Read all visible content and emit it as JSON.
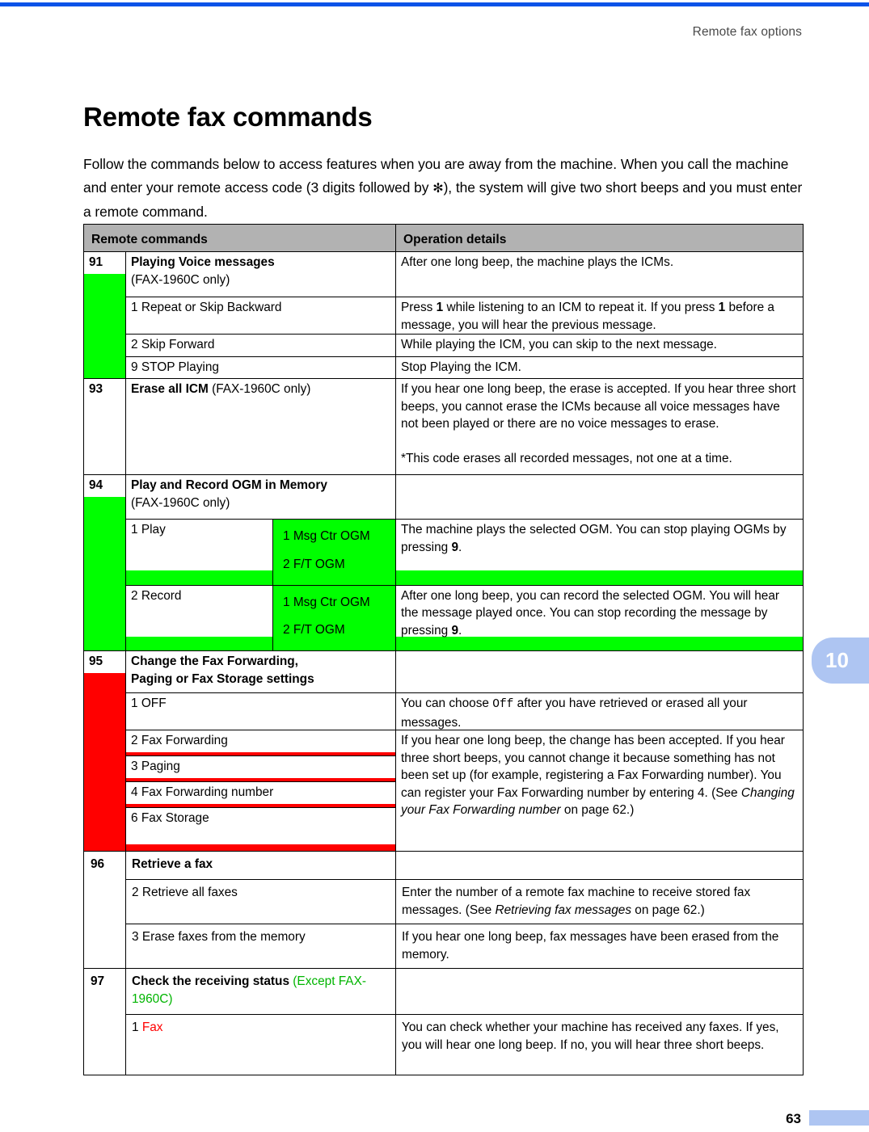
{
  "header": {
    "running_head": "Remote fax options"
  },
  "page": {
    "title": "Remote fax commands",
    "intro_part1": "Follow the commands below to access features when you are away from the machine. When you call the machine and enter your remote access code (3 digits followed by ",
    "intro_star": "✻",
    "intro_part2": "), the system will give two short beeps and you must enter a remote command.",
    "number": "63",
    "chapter_tab": "10"
  },
  "colors": {
    "highlight_green": "#00ff00",
    "highlight_red": "#ff0000",
    "header_gray": "#b2b2b2",
    "tab_blue": "#aec5f2",
    "top_rule_blue": "#0b53e8"
  },
  "table": {
    "headers": {
      "commands": "Remote commands",
      "details": "Operation details"
    },
    "rows": [
      {
        "code": "91",
        "command_bold": "Playing Voice messages",
        "command_plain": "(FAX-1960C only)",
        "details": "After one long beep, the machine plays the ICMs.",
        "highlight": "green"
      },
      {
        "command": "1 Repeat or Skip Backward",
        "details_a": "Press ",
        "details_b": "1",
        "details_c": " while listening to an ICM to repeat it. If you press ",
        "details_d": "1",
        "details_e": " before a message, you will hear the previous message.",
        "highlight": "green"
      },
      {
        "command": "2 Skip Forward",
        "details": "While playing the ICM, you can skip to the next message.",
        "highlight": "green"
      },
      {
        "command": "9 STOP Playing",
        "details": "Stop Playing the ICM.",
        "highlight": "green"
      },
      {
        "code": "93",
        "command_bold": "Erase all ICM",
        "command_plain": " (FAX-1960C only)",
        "details_p1": "If you hear one long beep, the erase is accepted. If you hear three short beeps, you cannot erase the ICMs because all voice messages have not been played or there are no voice messages to erase.",
        "details_p2": "*This code erases all recorded messages, not one at a time.",
        "highlight": "green"
      },
      {
        "code": "94",
        "command_bold": "Play and Record OGM in Memory",
        "command_plain": "(FAX-1960C only)",
        "details": "",
        "highlight": "green"
      },
      {
        "command": "1 Play",
        "sub1": "1 Msg Ctr OGM",
        "sub2": "2 F/T OGM",
        "details_a": "The machine plays the selected OGM. You can stop playing OGMs by pressing ",
        "details_b": "9",
        "details_c": ".",
        "highlight": "green"
      },
      {
        "command": "2 Record",
        "sub1": "1 Msg Ctr OGM",
        "sub2": "2 F/T OGM",
        "details_a": "After one long beep, you can record the selected OGM. You will hear the message played once. You can stop recording the message by pressing ",
        "details_b": "9",
        "details_c": ".",
        "highlight": "green"
      },
      {
        "code": "95",
        "command_bold_l1": "Change the Fax Forwarding,",
        "command_bold_l2": "Paging or Fax Storage settings",
        "details": "",
        "highlight": "red"
      },
      {
        "command": "1 OFF",
        "details_a": "You can choose ",
        "details_b": "Off",
        "details_c": " after you have retrieved or erased all your messages.",
        "highlight": "red"
      },
      {
        "command": "2 Fax Forwarding",
        "highlight": "red",
        "details_a": "If you hear one long beep, the change has been accepted. If you hear three short beeps, you cannot change it because something has not been set up (for example, registering a Fax Forwarding number). You can register your Fax Forwarding number by entering 4. (See ",
        "details_italic": "Changing your Fax Forwarding number",
        "details_b": " on page 62.)"
      },
      {
        "command": "3 Paging",
        "highlight": "red"
      },
      {
        "command": "4 Fax Forwarding number",
        "highlight": "red"
      },
      {
        "command": "6 Fax Storage",
        "highlight": "red"
      },
      {
        "code": "96",
        "command_bold": "Retrieve a fax",
        "details": "",
        "highlight": "none"
      },
      {
        "command": "2 Retrieve all faxes",
        "details_a": "Enter the number of a remote fax machine to receive stored fax messages. (See ",
        "details_italic": "Retrieving fax messages",
        "details_b": " on page 62.)",
        "highlight": "none"
      },
      {
        "command": "3 Erase faxes from the memory",
        "details": "If you hear one long beep, fax messages have been erased from the memory.",
        "highlight": "none"
      },
      {
        "code": "97",
        "command_bold": "Check the receiving status",
        "command_green": " (Except FAX-1960C)",
        "details": "",
        "highlight": "none"
      },
      {
        "command_prefix": "1 ",
        "command_red": "Fax",
        "details": "You can check whether your machine has received any faxes. If yes, you will hear one long beep. If no, you will hear three short beeps.",
        "highlight": "none"
      }
    ]
  }
}
